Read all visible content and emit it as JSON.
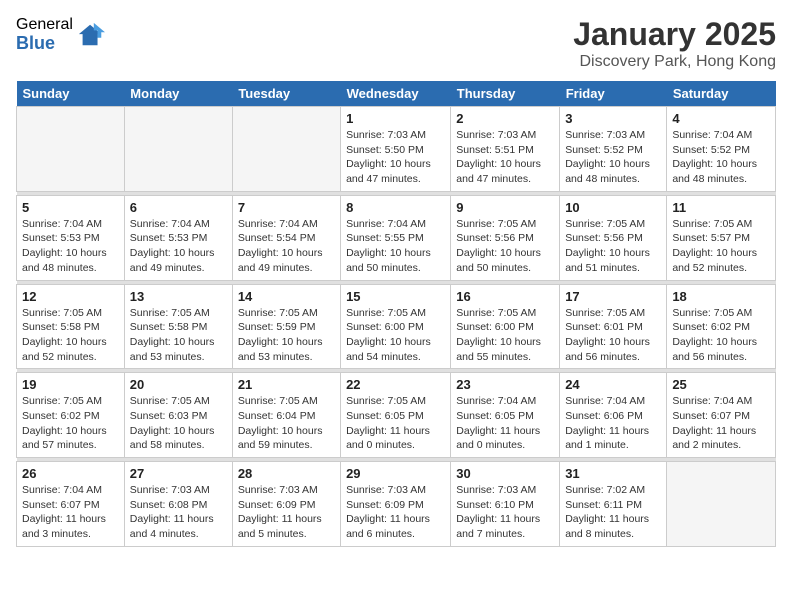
{
  "logo": {
    "general": "General",
    "blue": "Blue"
  },
  "header": {
    "title": "January 2025",
    "subtitle": "Discovery Park, Hong Kong"
  },
  "days_of_week": [
    "Sunday",
    "Monday",
    "Tuesday",
    "Wednesday",
    "Thursday",
    "Friday",
    "Saturday"
  ],
  "weeks": [
    [
      {
        "day": "",
        "info": ""
      },
      {
        "day": "",
        "info": ""
      },
      {
        "day": "",
        "info": ""
      },
      {
        "day": "1",
        "info": "Sunrise: 7:03 AM\nSunset: 5:50 PM\nDaylight: 10 hours\nand 47 minutes."
      },
      {
        "day": "2",
        "info": "Sunrise: 7:03 AM\nSunset: 5:51 PM\nDaylight: 10 hours\nand 47 minutes."
      },
      {
        "day": "3",
        "info": "Sunrise: 7:03 AM\nSunset: 5:52 PM\nDaylight: 10 hours\nand 48 minutes."
      },
      {
        "day": "4",
        "info": "Sunrise: 7:04 AM\nSunset: 5:52 PM\nDaylight: 10 hours\nand 48 minutes."
      }
    ],
    [
      {
        "day": "5",
        "info": "Sunrise: 7:04 AM\nSunset: 5:53 PM\nDaylight: 10 hours\nand 48 minutes."
      },
      {
        "day": "6",
        "info": "Sunrise: 7:04 AM\nSunset: 5:53 PM\nDaylight: 10 hours\nand 49 minutes."
      },
      {
        "day": "7",
        "info": "Sunrise: 7:04 AM\nSunset: 5:54 PM\nDaylight: 10 hours\nand 49 minutes."
      },
      {
        "day": "8",
        "info": "Sunrise: 7:04 AM\nSunset: 5:55 PM\nDaylight: 10 hours\nand 50 minutes."
      },
      {
        "day": "9",
        "info": "Sunrise: 7:05 AM\nSunset: 5:56 PM\nDaylight: 10 hours\nand 50 minutes."
      },
      {
        "day": "10",
        "info": "Sunrise: 7:05 AM\nSunset: 5:56 PM\nDaylight: 10 hours\nand 51 minutes."
      },
      {
        "day": "11",
        "info": "Sunrise: 7:05 AM\nSunset: 5:57 PM\nDaylight: 10 hours\nand 52 minutes."
      }
    ],
    [
      {
        "day": "12",
        "info": "Sunrise: 7:05 AM\nSunset: 5:58 PM\nDaylight: 10 hours\nand 52 minutes."
      },
      {
        "day": "13",
        "info": "Sunrise: 7:05 AM\nSunset: 5:58 PM\nDaylight: 10 hours\nand 53 minutes."
      },
      {
        "day": "14",
        "info": "Sunrise: 7:05 AM\nSunset: 5:59 PM\nDaylight: 10 hours\nand 53 minutes."
      },
      {
        "day": "15",
        "info": "Sunrise: 7:05 AM\nSunset: 6:00 PM\nDaylight: 10 hours\nand 54 minutes."
      },
      {
        "day": "16",
        "info": "Sunrise: 7:05 AM\nSunset: 6:00 PM\nDaylight: 10 hours\nand 55 minutes."
      },
      {
        "day": "17",
        "info": "Sunrise: 7:05 AM\nSunset: 6:01 PM\nDaylight: 10 hours\nand 56 minutes."
      },
      {
        "day": "18",
        "info": "Sunrise: 7:05 AM\nSunset: 6:02 PM\nDaylight: 10 hours\nand 56 minutes."
      }
    ],
    [
      {
        "day": "19",
        "info": "Sunrise: 7:05 AM\nSunset: 6:02 PM\nDaylight: 10 hours\nand 57 minutes."
      },
      {
        "day": "20",
        "info": "Sunrise: 7:05 AM\nSunset: 6:03 PM\nDaylight: 10 hours\nand 58 minutes."
      },
      {
        "day": "21",
        "info": "Sunrise: 7:05 AM\nSunset: 6:04 PM\nDaylight: 10 hours\nand 59 minutes."
      },
      {
        "day": "22",
        "info": "Sunrise: 7:05 AM\nSunset: 6:05 PM\nDaylight: 11 hours\nand 0 minutes."
      },
      {
        "day": "23",
        "info": "Sunrise: 7:04 AM\nSunset: 6:05 PM\nDaylight: 11 hours\nand 0 minutes."
      },
      {
        "day": "24",
        "info": "Sunrise: 7:04 AM\nSunset: 6:06 PM\nDaylight: 11 hours\nand 1 minute."
      },
      {
        "day": "25",
        "info": "Sunrise: 7:04 AM\nSunset: 6:07 PM\nDaylight: 11 hours\nand 2 minutes."
      }
    ],
    [
      {
        "day": "26",
        "info": "Sunrise: 7:04 AM\nSunset: 6:07 PM\nDaylight: 11 hours\nand 3 minutes."
      },
      {
        "day": "27",
        "info": "Sunrise: 7:03 AM\nSunset: 6:08 PM\nDaylight: 11 hours\nand 4 minutes."
      },
      {
        "day": "28",
        "info": "Sunrise: 7:03 AM\nSunset: 6:09 PM\nDaylight: 11 hours\nand 5 minutes."
      },
      {
        "day": "29",
        "info": "Sunrise: 7:03 AM\nSunset: 6:09 PM\nDaylight: 11 hours\nand 6 minutes."
      },
      {
        "day": "30",
        "info": "Sunrise: 7:03 AM\nSunset: 6:10 PM\nDaylight: 11 hours\nand 7 minutes."
      },
      {
        "day": "31",
        "info": "Sunrise: 7:02 AM\nSunset: 6:11 PM\nDaylight: 11 hours\nand 8 minutes."
      },
      {
        "day": "",
        "info": ""
      }
    ]
  ]
}
